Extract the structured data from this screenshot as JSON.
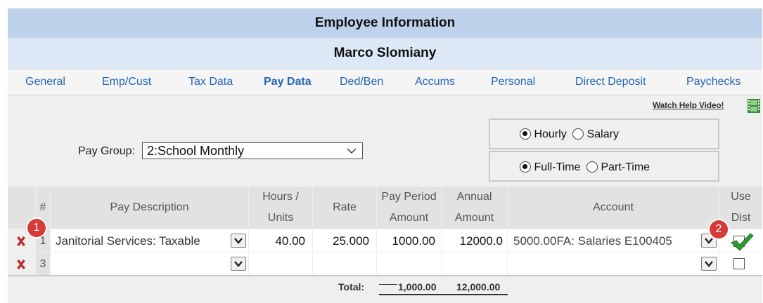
{
  "header": {
    "title": "Employee Information",
    "employee_name": "Marco Slomiany"
  },
  "tabs": [
    {
      "label": "General",
      "active": false
    },
    {
      "label": "Emp/Cust",
      "active": false
    },
    {
      "label": "Tax Data",
      "active": false
    },
    {
      "label": "Pay Data",
      "active": true
    },
    {
      "label": "Ded/Ben",
      "active": false
    },
    {
      "label": "Accums",
      "active": false
    },
    {
      "label": "Personal",
      "active": false
    },
    {
      "label": "Direct Deposit",
      "active": false
    },
    {
      "label": "Paychecks",
      "active": false
    }
  ],
  "help_link": "Watch Help Video!",
  "pay_group": {
    "label": "Pay Group:",
    "value": "2:School Monthly"
  },
  "pay_type": {
    "hourly": "Hourly",
    "salary": "Salary",
    "selected": "Hourly"
  },
  "employment": {
    "full_time": "Full-Time",
    "part_time": "Part-Time",
    "selected": "Full-Time"
  },
  "grid": {
    "columns": {
      "num": "#",
      "desc": "Pay Description",
      "hours": [
        "Hours /",
        "Units"
      ],
      "rate": "Rate",
      "ppa": [
        "Pay Period",
        "Amount"
      ],
      "annual": [
        "Annual",
        "Amount"
      ],
      "account": "Account",
      "usedist": [
        "Use",
        "Dist"
      ]
    },
    "rows": [
      {
        "num": "1",
        "desc": "Janitorial Services: Taxable",
        "hours": "40.00",
        "rate": "25.000",
        "ppa": "1000.00",
        "annual": "12000.0",
        "account": "5000.00FA: Salaries E100405",
        "use_dist": true
      },
      {
        "num": "3",
        "desc": "",
        "hours": "",
        "rate": "",
        "ppa": "",
        "annual": "",
        "account": "",
        "use_dist": false
      }
    ],
    "total": {
      "label": "Total:",
      "ppa": "1,000.00",
      "annual": "12,000.00"
    }
  },
  "callouts": [
    "1",
    "2"
  ],
  "colors": {
    "header_bg": "#bed2ec",
    "subheader_bg": "#dde8f7",
    "tab_text": "#2366b5",
    "delete_red": "#b8332f",
    "badge_red": "#d63b3b",
    "check_green": "#2e9b34"
  }
}
